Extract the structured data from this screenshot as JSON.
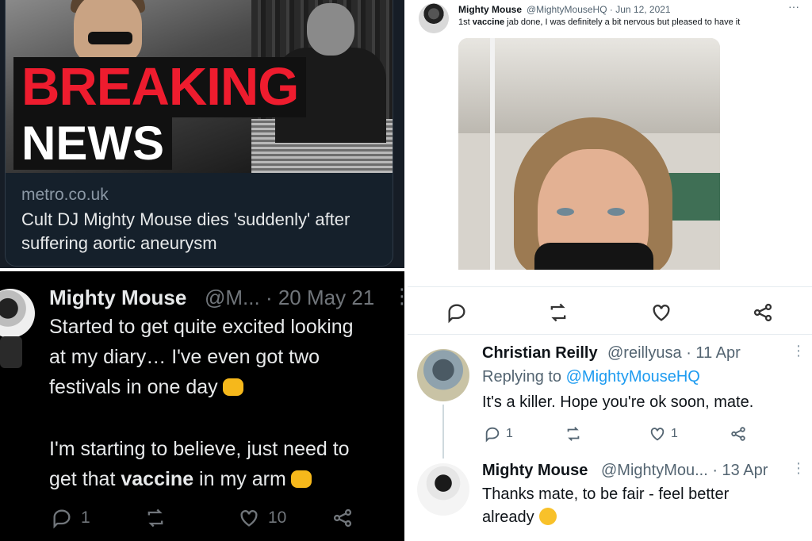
{
  "panel_news": {
    "banner_word1": "BREAKING",
    "banner_word2": "NEWS",
    "domain": "metro.co.uk",
    "headline": "Cult DJ Mighty Mouse dies 'suddenly' after suffering aortic aneurysm"
  },
  "panel_vaccine_tweet": {
    "name": "Mighty Mouse",
    "meta": "@MightyMouseHQ · Jun 12, 2021",
    "more": "···",
    "text_before": "1st ",
    "text_bold": "vaccine",
    "text_after": " jab done, I was definitely a bit nervous but pleased to have it"
  },
  "panel_diary_tweet": {
    "name": "Mighty Mouse",
    "meta": "@M... · 20 May 21",
    "more": "⋮",
    "line1": "Started to get quite excited looking",
    "line2": "at my diary… I've even got two",
    "line3": "festivals in one day",
    "line4": "I'm starting to believe, just need to",
    "line5_before": "get that ",
    "line5_bold": "vaccine",
    "line5_after": " in my arm",
    "reply_count": "1",
    "like_count": "10",
    "emoji_fist": "fist-emoji",
    "emoji_hands": "raised-hands-emoji"
  },
  "panel_thread": {
    "reply1": {
      "name": "Christian Reilly",
      "meta": "@reillyusa · 11 Apr",
      "replying_label": "Replying to ",
      "replying_handle": "@MightyMouseHQ",
      "text": "It's a killer. Hope you're ok soon, mate.",
      "reply_count": "1",
      "like_count": "1"
    },
    "reply2": {
      "name": "Mighty Mouse",
      "meta": "@MightyMou... · 13 Apr",
      "text_line1": "Thanks mate, to be fair - feel better",
      "text_line2": "already",
      "emoji": "kiss-face-emoji"
    },
    "more": "⋮"
  },
  "colors": {
    "breaking_red": "#ee1c2e",
    "link_blue": "#1d9bf0",
    "dark_bg": "#000000",
    "dark_card": "#15202b"
  }
}
